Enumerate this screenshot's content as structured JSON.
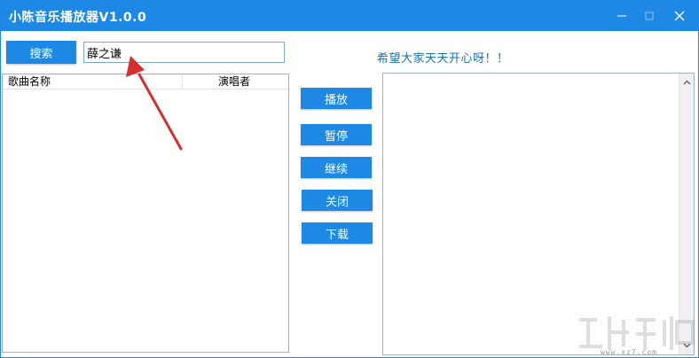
{
  "window": {
    "title": "小陈音乐播放器V1.0.0"
  },
  "search": {
    "button_label": "搜索",
    "input_value": "薛之谦"
  },
  "slogan": "希望大家天天开心呀！！",
  "song_list": {
    "columns": [
      "歌曲名称",
      "演唱者"
    ],
    "rows": []
  },
  "controls": {
    "play": "播放",
    "pause": "暂停",
    "resume": "继续",
    "close": "关闭",
    "download": "下载"
  },
  "watermark": {
    "url": "www.xz7.com"
  },
  "colors": {
    "accent": "#1e88e5",
    "annotation_arrow": "#d32f2f",
    "slogan_text": "#1b6fb3"
  },
  "icons": {
    "minimize": "minimize-icon",
    "maximize": "maximize-icon",
    "close": "close-icon",
    "scroll_up": "chevron-up-icon",
    "scroll_down": "chevron-down-icon",
    "annotation": "red-arrow-annotation"
  }
}
